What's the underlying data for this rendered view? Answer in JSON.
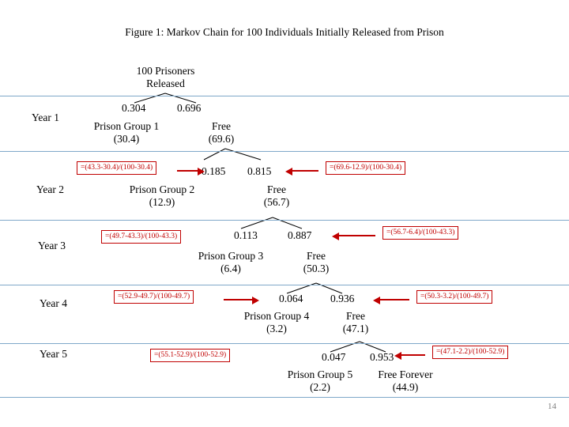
{
  "title": "Figure 1: Markov Chain for 100 Individuals Initially Released from Prison",
  "root": {
    "line1": "100 Prisoners",
    "line2": "Released"
  },
  "years": [
    {
      "label": "Year 1"
    },
    {
      "label": "Year 2"
    },
    {
      "label": "Year 3"
    },
    {
      "label": "Year 4"
    },
    {
      "label": "Year 5"
    }
  ],
  "levels": [
    {
      "prison_prob": "0.304",
      "free_prob": "0.696",
      "prison_name": "Prison Group 1",
      "prison_value": "(30.4)",
      "free_name": "Free",
      "free_value": "(69.6)",
      "left_formula": "",
      "right_formula": ""
    },
    {
      "prison_prob": "0.185",
      "free_prob": "0.815",
      "prison_name": "Prison Group 2",
      "prison_value": "(12.9)",
      "free_name": "Free",
      "free_value": "(56.7)",
      "left_formula": "=(43.3-30.4)/(100-30.4)",
      "right_formula": "=(69.6-12.9)/(100-30.4)"
    },
    {
      "prison_prob": "0.113",
      "free_prob": "0.887",
      "prison_name": "Prison Group 3",
      "prison_value": "(6.4)",
      "free_name": "Free",
      "free_value": "(50.3)",
      "left_formula": "=(49.7-43.3)/(100-43.3)",
      "right_formula": "=(56.7-6.4)/(100-43.3)"
    },
    {
      "prison_prob": "0.064",
      "free_prob": "0.936",
      "prison_name": "Prison Group 4",
      "prison_value": "(3.2)",
      "free_name": "Free",
      "free_value": "(47.1)",
      "left_formula": "=(52.9-49.7)/(100-49.7)",
      "right_formula": "=(50.3-3.2)/(100-49.7)"
    },
    {
      "prison_prob": "0.047",
      "free_prob": "0.953",
      "prison_name": "Prison Group 5",
      "prison_value": "(2.2)",
      "free_name": "Free Forever",
      "free_value": "(44.9)",
      "left_formula": "=(55.1-52.9)/(100-52.9)",
      "right_formula": "=(47.1-2.2)/(100-52.9)"
    }
  ],
  "page_number": "14"
}
